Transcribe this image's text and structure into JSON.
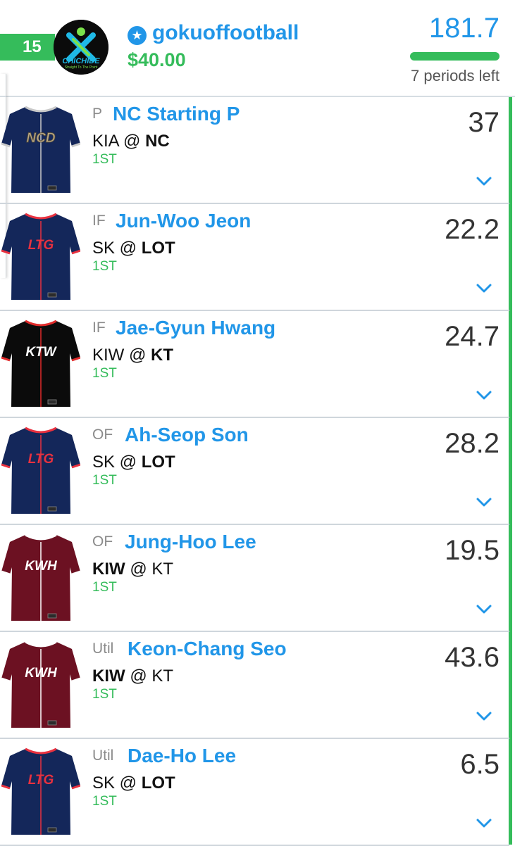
{
  "header": {
    "rank": "15",
    "username": "gokuoffootball",
    "winnings": "$40.00",
    "total_points": "181.7",
    "periods_left": "7 periods left",
    "progress": 1.0,
    "avatar": {
      "logo_text": "CHICHIDE",
      "tagline": "Straight To The Point",
      "icon": "x-man-logo"
    }
  },
  "lineup": [
    {
      "pos": "P",
      "name": "NC Starting P",
      "away": "KIA",
      "home": "NC",
      "bold": "home",
      "inning": "1ST",
      "points": "37",
      "jersey": {
        "team": "NCD",
        "color": "#14275a",
        "text_color": "#b8a886",
        "trim": "#c9c9c9"
      }
    },
    {
      "pos": "IF",
      "name": "Jun-Woo Jeon",
      "away": "SK",
      "home": "LOT",
      "bold": "home",
      "inning": "1ST",
      "points": "22.2",
      "jersey": {
        "team": "LTG",
        "color": "#14275a",
        "text_color": "#e8313f",
        "trim": "#e8313f"
      }
    },
    {
      "pos": "IF",
      "name": "Jae-Gyun Hwang",
      "away": "KIW",
      "home": "KT",
      "bold": "home",
      "inning": "1ST",
      "points": "24.7",
      "jersey": {
        "team": "KTW",
        "color": "#0b0b0b",
        "text_color": "#ffffff",
        "trim": "#e02b2b"
      }
    },
    {
      "pos": "OF",
      "name": "Ah-Seop Son",
      "away": "SK",
      "home": "LOT",
      "bold": "home",
      "inning": "1ST",
      "points": "28.2",
      "jersey": {
        "team": "LTG",
        "color": "#14275a",
        "text_color": "#e8313f",
        "trim": "#e8313f"
      }
    },
    {
      "pos": "OF",
      "name": "Jung-Hoo Lee",
      "away": "KIW",
      "home": "KT",
      "bold": "away",
      "inning": "1ST",
      "points": "19.5",
      "jersey": {
        "team": "KWH",
        "color": "#6c1122",
        "text_color": "#ffffff",
        "trim": "#ffffff"
      }
    },
    {
      "pos": "Util",
      "name": "Keon-Chang Seo",
      "away": "KIW",
      "home": "KT",
      "bold": "away",
      "inning": "1ST",
      "points": "43.6",
      "jersey": {
        "team": "KWH",
        "color": "#6c1122",
        "text_color": "#ffffff",
        "trim": "#ffffff"
      }
    },
    {
      "pos": "Util",
      "name": "Dae-Ho Lee",
      "away": "SK",
      "home": "LOT",
      "bold": "home",
      "inning": "1ST",
      "points": "6.5",
      "jersey": {
        "team": "LTG",
        "color": "#14275a",
        "text_color": "#e8313f",
        "trim": "#e8313f"
      }
    }
  ],
  "colors": {
    "blue": "#2196e8",
    "green": "#35bc5b",
    "divider": "#cfd6dc"
  }
}
